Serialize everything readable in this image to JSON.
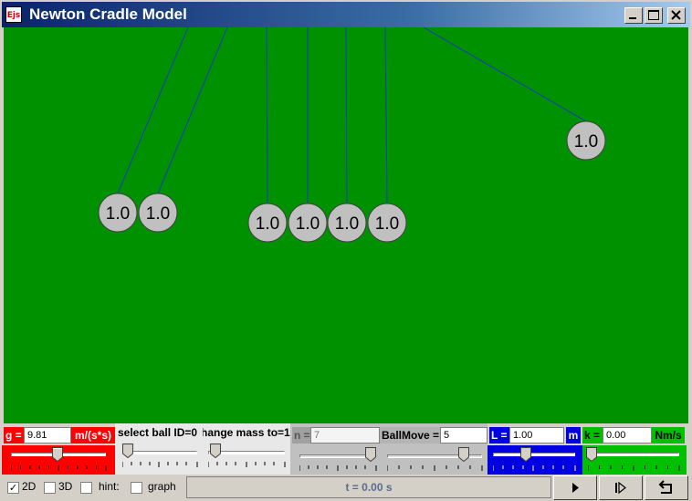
{
  "window": {
    "icon_text": "Ejs",
    "title": "Newton Cradle Model",
    "buttons": [
      "minimize",
      "maximize",
      "close"
    ]
  },
  "simulation": {
    "background_color": "#009100",
    "string_color": "#1c36c8",
    "ball_color": "#c0c0c0",
    "balls": [
      {
        "label": "1.0"
      },
      {
        "label": "1.0"
      },
      {
        "label": "1.0"
      },
      {
        "label": "1.0"
      },
      {
        "label": "1.0"
      },
      {
        "label": "1.0"
      },
      {
        "label": "1.0"
      }
    ]
  },
  "controls": {
    "g": {
      "label": "g =",
      "value": "9.81",
      "unit": "m/(s*s)",
      "slider_fraction": 0.55,
      "color": "#ff0000"
    },
    "select_ball": {
      "label": "select ball ID=0",
      "slider_fraction": 0.0
    },
    "change_mass": {
      "label": "hange mass to=1.",
      "slider_fraction": 0.1
    },
    "n": {
      "label": "n =",
      "value": "7",
      "slider_fraction": 1.0
    },
    "ball_move": {
      "label": "BallMove =",
      "value": "5",
      "slider_fraction": 0.9
    },
    "length": {
      "label": "L =",
      "value": "1.00",
      "unit": "m",
      "slider_fraction": 0.35,
      "color": "#0000e0"
    },
    "k": {
      "label": "k =",
      "value": "0.00",
      "unit": "Nm/s",
      "slider_fraction": 0.0,
      "color": "#00c000"
    }
  },
  "bottom_bar": {
    "checkboxes": [
      {
        "label": "2D",
        "checked": true
      },
      {
        "label": "3D",
        "checked": false
      },
      {
        "label": "hint:",
        "checked": false
      },
      {
        "label": "graph",
        "checked": false
      }
    ],
    "time_label": "t = 0.00 s",
    "buttons": [
      "play-icon",
      "step-icon",
      "reset-icon"
    ]
  }
}
